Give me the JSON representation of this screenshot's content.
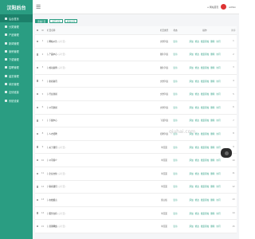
{
  "brand": {
    "logo_text": "汉阳后台"
  },
  "sidebar": {
    "items": [
      {
        "label": "后台首页"
      },
      {
        "label": "分类管理"
      },
      {
        "label": "产品管理"
      },
      {
        "label": "新闻管理"
      },
      {
        "label": "案例管理"
      },
      {
        "label": "下载管理"
      },
      {
        "label": "招聘管理"
      },
      {
        "label": "留言管理"
      },
      {
        "label": "单页管理"
      },
      {
        "label": "友情链接"
      },
      {
        "label": "系统设置"
      }
    ]
  },
  "topbar": {
    "home_label": "网站首页",
    "user_label": "admin"
  },
  "toolbar": {
    "add_label": "添加栏目",
    "expand_label": "展开全部",
    "collapse_label": "折叠全部"
  },
  "table": {
    "headers": {
      "id": "ID",
      "title": "栏目名称",
      "type": "栏目类型",
      "status": "状态",
      "ops": "操作",
      "sort": "排序"
    },
    "rows": [
      {
        "id": "1",
        "title": "├ 网站公告",
        "sub": "(子栏目)",
        "type": "文章列表",
        "status": "显示"
      },
      {
        "id": "2",
        "title": "├ 产品中心",
        "sub": "(子栏目)",
        "type": "图片列表",
        "status": "显示"
      },
      {
        "id": "3",
        "title": "├ 成功案例",
        "sub": "(子栏目)",
        "type": "图片列表",
        "status": "显示"
      },
      {
        "id": "4",
        "title": "├ 新闻资讯",
        "sub": "",
        "type": "文章列表",
        "status": "显示"
      },
      {
        "id": "5",
        "title": "├ 行业新闻",
        "sub": "",
        "type": "文章列表",
        "status": "显示"
      },
      {
        "id": "6",
        "title": "├ 公司新闻",
        "sub": "",
        "type": "文章列表",
        "status": "显示"
      },
      {
        "id": "7",
        "title": "├ 下载中心",
        "sub": "",
        "type": "下载列表",
        "status": "显示"
      },
      {
        "id": "8",
        "title": "├ 人才招聘",
        "sub": "",
        "type": "招聘列表",
        "status": "显示"
      },
      {
        "id": "9",
        "title": "├ 关于我们",
        "sub": "(子栏目)",
        "type": "单页面",
        "status": "显示"
      },
      {
        "id": "10",
        "title": "├ 公司简介",
        "sub": "",
        "type": "单页面",
        "status": "显示"
      },
      {
        "id": "11",
        "title": "├ 企业文化",
        "sub": "(子栏目)",
        "type": "单页面",
        "status": "显示"
      },
      {
        "id": "12",
        "title": "├ 联系我们",
        "sub": "(子栏目)",
        "type": "单页面",
        "status": "显示"
      },
      {
        "id": "13",
        "title": "├ 在线留言",
        "sub": "",
        "type": "留言板",
        "status": "显示"
      },
      {
        "id": "14",
        "title": "├ 服务支持",
        "sub": "(子栏目)",
        "type": "单页面",
        "status": "显示"
      },
      {
        "id": "15",
        "title": "├ 营销网络",
        "sub": "(子栏目)",
        "type": "单页面",
        "status": "显示"
      }
    ],
    "ops": {
      "add": "添加",
      "edit": "修改",
      "batch": "批量添加",
      "delete": "删除",
      "visit": "访问"
    }
  },
  "watermark": {
    "text": "qiuhai.com"
  },
  "colors": {
    "accent": "#2a9d82",
    "sidebar_active": "#1c806a"
  },
  "icons": {
    "menu": "hamburger-icon",
    "home": "home-icon",
    "float": "chat-icon"
  }
}
